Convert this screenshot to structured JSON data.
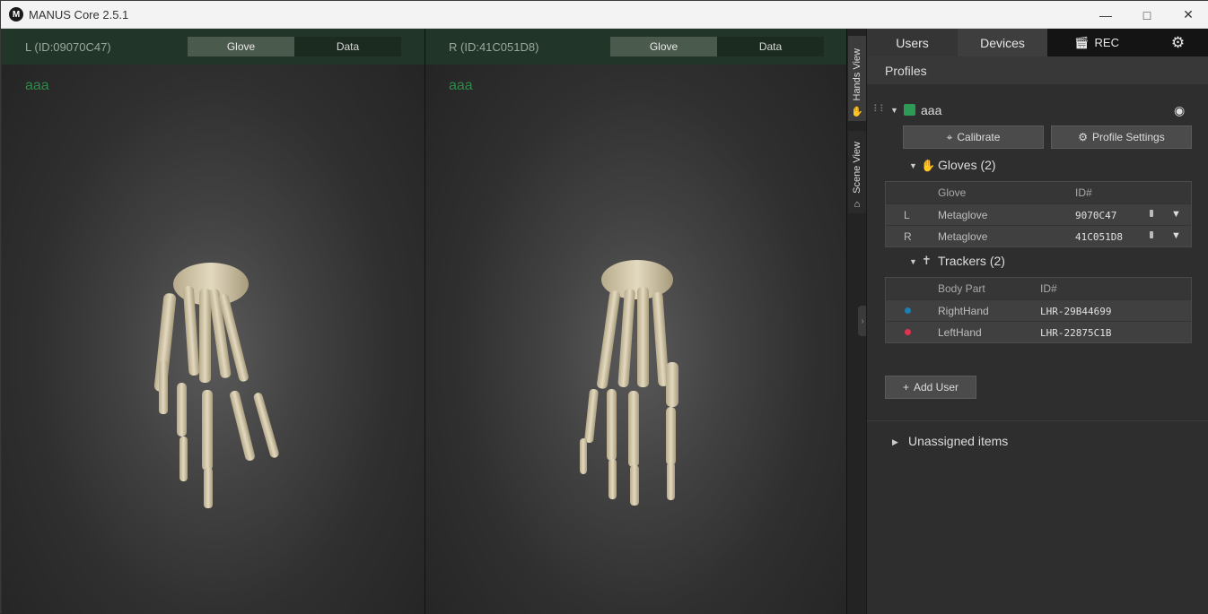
{
  "window": {
    "title": "MANUS Core 2.5.1",
    "logo_letter": "M"
  },
  "left_pane": {
    "id_label": "L (ID:09070C47)",
    "seg_glove": "Glove",
    "seg_data": "Data",
    "user": "aaa"
  },
  "right_pane": {
    "id_label": "R (ID:41C051D8)",
    "seg_glove": "Glove",
    "seg_data": "Data",
    "user": "aaa"
  },
  "side_tabs": {
    "hands_view": "Hands View",
    "scene_view": "Scene View"
  },
  "nav": {
    "users": "Users",
    "devices": "Devices",
    "rec": "REC"
  },
  "profiles": {
    "title": "Profiles",
    "user": {
      "name": "aaa",
      "calibrate_label": "Calibrate",
      "profile_settings_label": "Profile Settings",
      "gloves_title": "Gloves (2)",
      "gloves_headers": {
        "glove": "Glove",
        "id": "ID#"
      },
      "gloves": [
        {
          "side": "L",
          "name": "Metaglove",
          "id": "9070C47"
        },
        {
          "side": "R",
          "name": "Metaglove",
          "id": "41C051D8"
        }
      ],
      "trackers_title": "Trackers (2)",
      "trackers_headers": {
        "body_part": "Body Part",
        "id": "ID#"
      },
      "trackers": [
        {
          "body_part": "RightHand",
          "id": "LHR-29B44699",
          "color": "#1d7fb0"
        },
        {
          "body_part": "LeftHand",
          "id": "LHR-22875C1B",
          "color": "#e0334f"
        }
      ]
    },
    "add_user_label": "Add User",
    "unassigned_label": "Unassigned items"
  },
  "colors": {
    "accent_green": "#2d9b55",
    "header_green": "#213528"
  }
}
